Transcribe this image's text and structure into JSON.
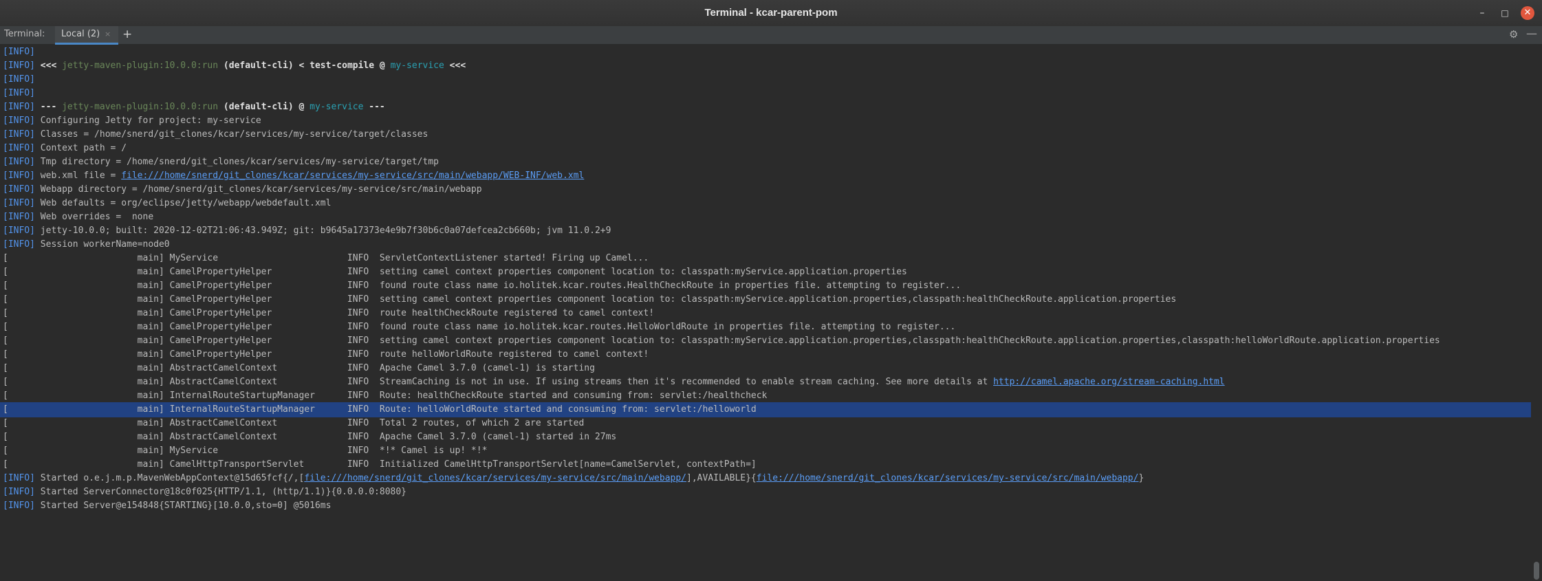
{
  "window": {
    "title": "Terminal - kcar-parent-pom"
  },
  "tabs": {
    "label": "Terminal:",
    "active": "Local (2)",
    "close": "×",
    "add": "+"
  },
  "terminal": {
    "l0": "[INFO]",
    "l1a": "[INFO]",
    "l1b": " <<< ",
    "l1c": "jetty-maven-plugin:10.0.0:run",
    "l1d": " (default-cli)",
    "l1e": " < test-compile @ ",
    "l1f": "my-service",
    "l1g": " <<<",
    "l2": "[INFO]",
    "l3": "[INFO]",
    "l4a": "[INFO]",
    "l4b": " --- ",
    "l4c": "jetty-maven-plugin:10.0.0:run",
    "l4d": " (default-cli)",
    "l4e": " @ ",
    "l4f": "my-service",
    "l4g": " ---",
    "l5a": "[INFO]",
    "l5b": " Configuring Jetty for project: my-service",
    "l6a": "[INFO]",
    "l6b": " Classes = /home/snerd/git_clones/kcar/services/my-service/target/classes",
    "l7a": "[INFO]",
    "l7b": " Context path = /",
    "l8a": "[INFO]",
    "l8b": " Tmp directory = /home/snerd/git_clones/kcar/services/my-service/target/tmp",
    "l9a": "[INFO]",
    "l9b": " web.xml file = ",
    "l9c": "file:///home/snerd/git_clones/kcar/services/my-service/src/main/webapp/WEB-INF/web.xml",
    "l10a": "[INFO]",
    "l10b": " Webapp directory = /home/snerd/git_clones/kcar/services/my-service/src/main/webapp",
    "l11a": "[INFO]",
    "l11b": " Web defaults = org/eclipse/jetty/webapp/webdefault.xml",
    "l12a": "[INFO]",
    "l12b": " Web overrides =  none",
    "l13a": "[INFO]",
    "l13b": " jetty-10.0.0; built: 2020-12-02T21:06:43.949Z; git: b9645a17373e4e9b7f30b6c0a07defcea2cb660b; jvm 11.0.2+9",
    "l14a": "[INFO]",
    "l14b": " Session workerName=node0",
    "l15": "[                        main] MyService                        INFO  ServletContextListener started! Firing up Camel...",
    "l16": "[                        main] CamelPropertyHelper              INFO  setting camel context properties component location to: classpath:myService.application.properties",
    "l17": "[                        main] CamelPropertyHelper              INFO  found route class name io.holitek.kcar.routes.HealthCheckRoute in properties file. attempting to register...",
    "l18": "[                        main] CamelPropertyHelper              INFO  setting camel context properties component location to: classpath:myService.application.properties,classpath:healthCheckRoute.application.properties",
    "l19": "[                        main] CamelPropertyHelper              INFO  route healthCheckRoute registered to camel context!",
    "l20": "[                        main] CamelPropertyHelper              INFO  found route class name io.holitek.kcar.routes.HelloWorldRoute in properties file. attempting to register...",
    "l21": "[                        main] CamelPropertyHelper              INFO  setting camel context properties component location to: classpath:myService.application.properties,classpath:healthCheckRoute.application.properties,classpath:helloWorldRoute.application.properties",
    "l22": "[                        main] CamelPropertyHelper              INFO  route helloWorldRoute registered to camel context!",
    "l23": "[                        main] AbstractCamelContext             INFO  Apache Camel 3.7.0 (camel-1) is starting",
    "l24a": "[                        main] AbstractCamelContext             INFO  StreamCaching is not in use. If using streams then it's recommended to enable stream caching. See more details at ",
    "l24b": "http://camel.apache.org/stream-caching.html",
    "l25": "[                        main] InternalRouteStartupManager      INFO  Route: healthCheckRoute started and consuming from: servlet:/healthcheck",
    "l26": "[                        main] InternalRouteStartupManager      INFO  Route: helloWorldRoute started and consuming from: servlet:/helloworld",
    "l27": "[                        main] AbstractCamelContext             INFO  Total 2 routes, of which 2 are started",
    "l28": "[                        main] AbstractCamelContext             INFO  Apache Camel 3.7.0 (camel-1) started in 27ms",
    "l29": "[                        main] MyService                        INFO  *!* Camel is up! *!*",
    "l30": "[                        main] CamelHttpTransportServlet        INFO  Initialized CamelHttpTransportServlet[name=CamelServlet, contextPath=]",
    "l31a": "[INFO]",
    "l31b": " Started o.e.j.m.p.MavenWebAppContext@15d65fcf{/,[",
    "l31c": "file:///home/snerd/git_clones/kcar/services/my-service/src/main/webapp/",
    "l31d": "],AVAILABLE}{",
    "l31e": "file:///home/snerd/git_clones/kcar/services/my-service/src/main/webapp/",
    "l31f": "}",
    "l32a": "[INFO]",
    "l32b": " Started ServerConnector@18c0f025{HTTP/1.1, (http/1.1)}{0.0.0.0:8080}",
    "l33a": "[INFO]",
    "l33b": " Started Server@e154848{STARTING}[10.0.0,sto=0] @5016ms"
  }
}
